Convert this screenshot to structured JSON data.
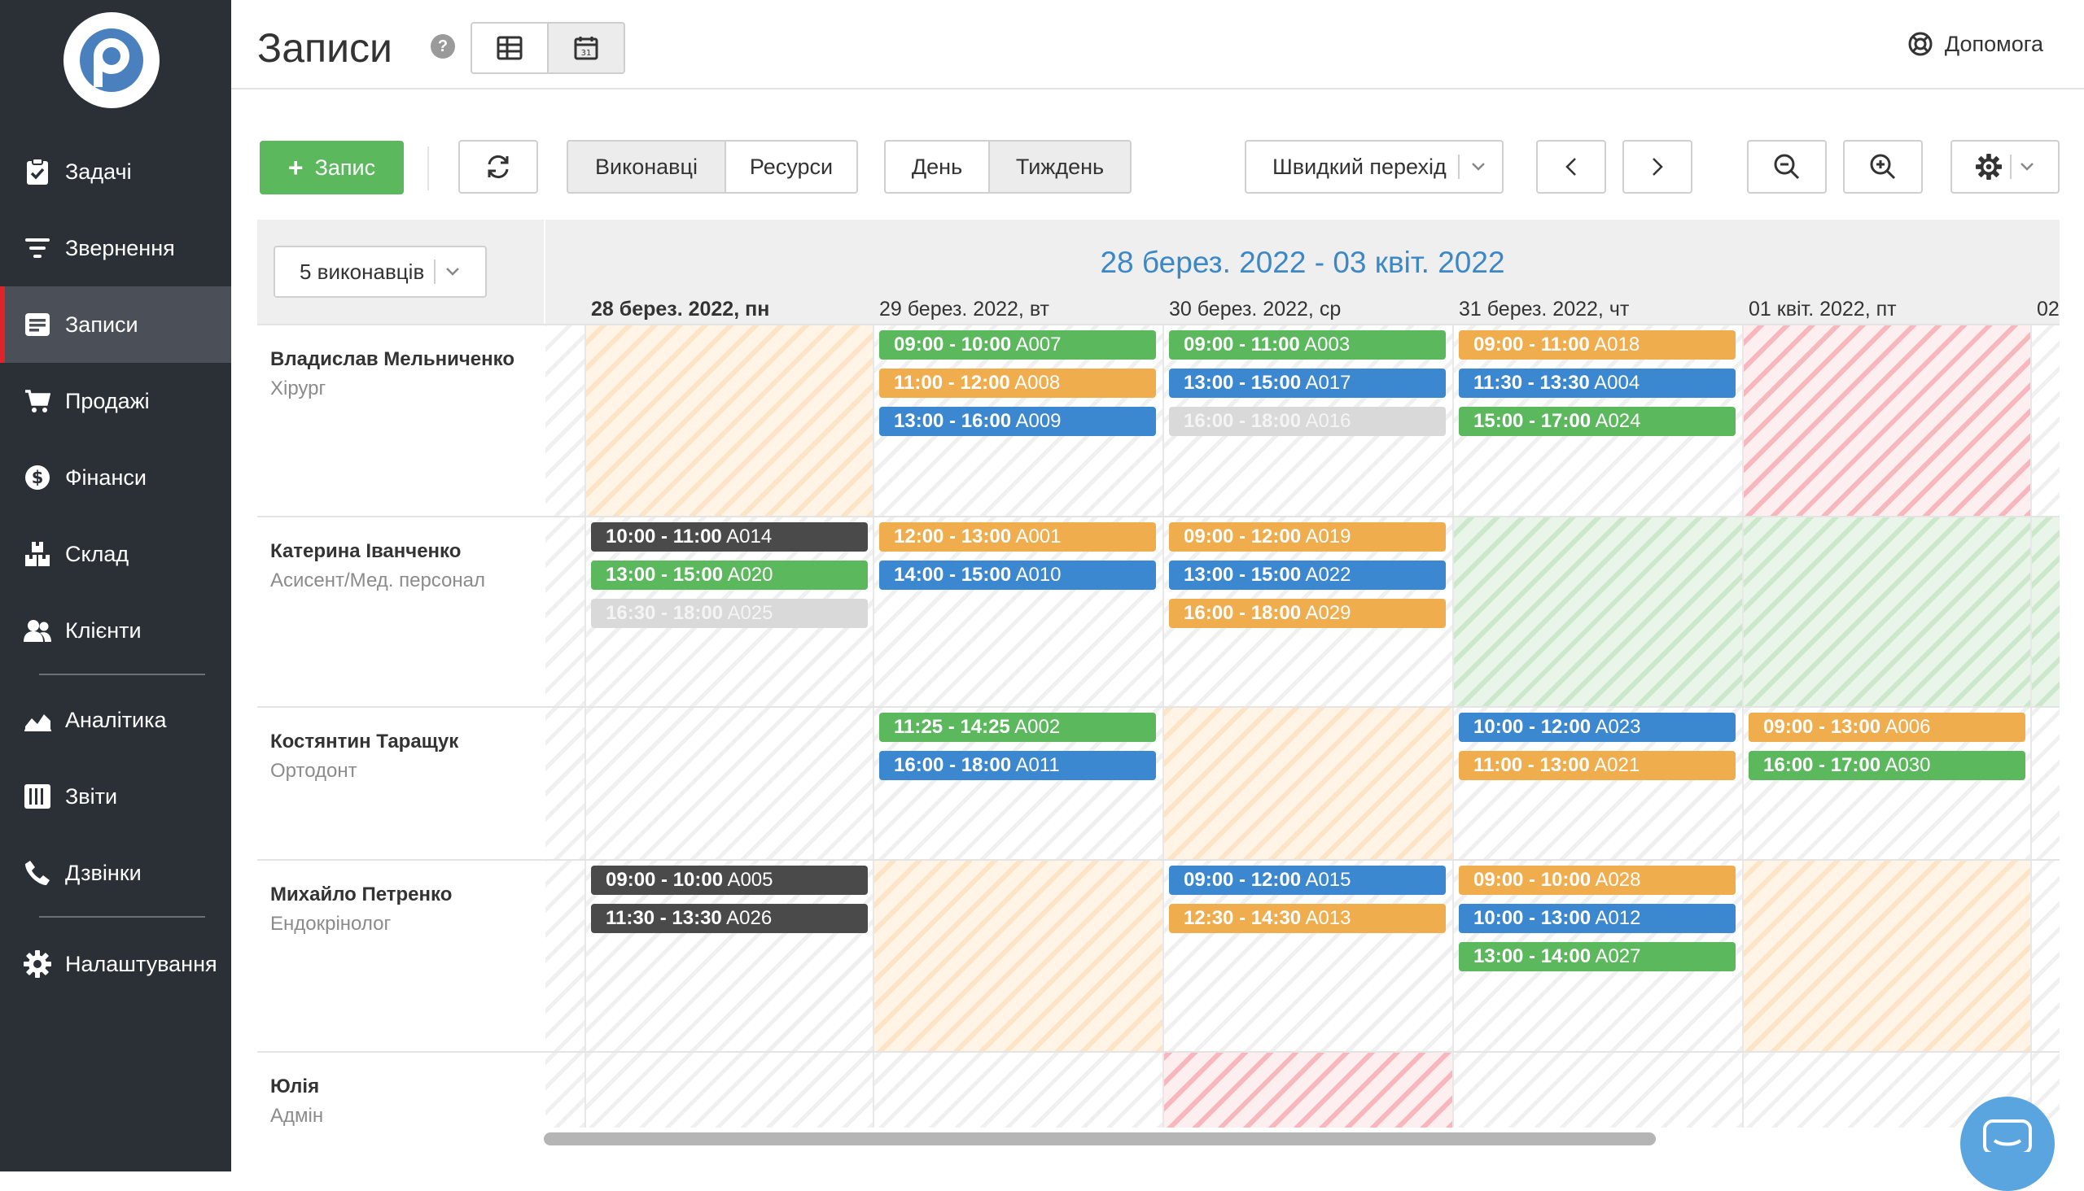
{
  "sidebar": {
    "items": [
      {
        "label": "Задачі",
        "icon": "clipboard-check-icon"
      },
      {
        "label": "Звернення",
        "icon": "filter-icon"
      },
      {
        "label": "Записи",
        "icon": "calendar-list-icon",
        "active": true
      },
      {
        "label": "Продажі",
        "icon": "cart-icon"
      },
      {
        "label": "Фінанси",
        "icon": "dollar-icon"
      },
      {
        "label": "Склад",
        "icon": "boxes-icon"
      },
      {
        "label": "Клієнти",
        "icon": "users-icon"
      },
      {
        "label": "Аналітика",
        "icon": "chart-area-icon"
      },
      {
        "label": "Звіти",
        "icon": "report-list-icon"
      },
      {
        "label": "Дзвінки",
        "icon": "phone-icon"
      },
      {
        "label": "Налаштування",
        "icon": "gear-icon"
      }
    ]
  },
  "header": {
    "title": "Записи",
    "help_label": "Допомога"
  },
  "toolbar": {
    "add_label": "Запис",
    "performers_label": "Виконавці",
    "resources_label": "Ресурси",
    "day_label": "День",
    "week_label": "Тиждень",
    "quick_jump_label": "Швидкий перехід"
  },
  "calendar": {
    "performers_filter": "5 виконавців",
    "range": "28 берез. 2022 - 03 квіт. 2022",
    "days": [
      "28 берез. 2022, пн",
      "29 берез. 2022, вт",
      "30 берез. 2022, ср",
      "31 берез. 2022, чт",
      "01 квіт. 2022, пт",
      "02"
    ],
    "performers": [
      {
        "name": "Владислав Мельниченко",
        "role": "Хірург"
      },
      {
        "name": "Катерина Іванченко",
        "role": "Асисент/Мед. персонал"
      },
      {
        "name": "Костянтин Таращук",
        "role": "Ортодонт"
      },
      {
        "name": "Михайло Петренко",
        "role": "Ендокрінолог"
      },
      {
        "name": "Юлія",
        "role": "Адмін"
      }
    ],
    "events": [
      {
        "performer": 0,
        "day": 1,
        "slot": 0,
        "time": "09:00 - 10:00",
        "code": "A007",
        "color": "#5bb85d"
      },
      {
        "performer": 0,
        "day": 1,
        "slot": 1,
        "time": "11:00 - 12:00",
        "code": "A008",
        "color": "#f0ad4e"
      },
      {
        "performer": 0,
        "day": 1,
        "slot": 2,
        "time": "13:00 - 16:00",
        "code": "A009",
        "color": "#3c88d0"
      },
      {
        "performer": 0,
        "day": 2,
        "slot": 0,
        "time": "09:00 - 11:00",
        "code": "A003",
        "color": "#5bb85d"
      },
      {
        "performer": 0,
        "day": 2,
        "slot": 1,
        "time": "13:00 - 15:00",
        "code": "A017",
        "color": "#3c88d0"
      },
      {
        "performer": 0,
        "day": 2,
        "slot": 2,
        "time": "16:00 - 18:00",
        "code": "A016",
        "color": "#d9d9d9"
      },
      {
        "performer": 0,
        "day": 3,
        "slot": 0,
        "time": "09:00 - 11:00",
        "code": "A018",
        "color": "#f0ad4e"
      },
      {
        "performer": 0,
        "day": 3,
        "slot": 1,
        "time": "11:30 - 13:30",
        "code": "A004",
        "color": "#3c88d0"
      },
      {
        "performer": 0,
        "day": 3,
        "slot": 2,
        "time": "15:00 - 17:00",
        "code": "A024",
        "color": "#5bb85d"
      },
      {
        "performer": 1,
        "day": 0,
        "slot": 0,
        "time": "10:00 - 11:00",
        "code": "A014",
        "color": "#4a4a4a"
      },
      {
        "performer": 1,
        "day": 0,
        "slot": 1,
        "time": "13:00 - 15:00",
        "code": "A020",
        "color": "#5bb85d"
      },
      {
        "performer": 1,
        "day": 0,
        "slot": 2,
        "time": "16:30 - 18:00",
        "code": "A025",
        "color": "#d9d9d9"
      },
      {
        "performer": 1,
        "day": 1,
        "slot": 0,
        "time": "12:00 - 13:00",
        "code": "A001",
        "color": "#f0ad4e"
      },
      {
        "performer": 1,
        "day": 1,
        "slot": 1,
        "time": "14:00 - 15:00",
        "code": "A010",
        "color": "#3c88d0"
      },
      {
        "performer": 1,
        "day": 2,
        "slot": 0,
        "time": "09:00 - 12:00",
        "code": "A019",
        "color": "#f0ad4e"
      },
      {
        "performer": 1,
        "day": 2,
        "slot": 1,
        "time": "13:00 - 15:00",
        "code": "A022",
        "color": "#3c88d0"
      },
      {
        "performer": 1,
        "day": 2,
        "slot": 2,
        "time": "16:00 - 18:00",
        "code": "A029",
        "color": "#f0ad4e"
      },
      {
        "performer": 2,
        "day": 1,
        "slot": 0,
        "time": "11:25 - 14:25",
        "code": "A002",
        "color": "#5bb85d"
      },
      {
        "performer": 2,
        "day": 1,
        "slot": 1,
        "time": "16:00 - 18:00",
        "code": "A011",
        "color": "#3c88d0"
      },
      {
        "performer": 2,
        "day": 3,
        "slot": 0,
        "time": "10:00 - 12:00",
        "code": "A023",
        "color": "#3c88d0"
      },
      {
        "performer": 2,
        "day": 3,
        "slot": 1,
        "time": "11:00 - 13:00",
        "code": "A021",
        "color": "#f0ad4e"
      },
      {
        "performer": 2,
        "day": 4,
        "slot": 0,
        "time": "09:00 - 13:00",
        "code": "A006",
        "color": "#f0ad4e"
      },
      {
        "performer": 2,
        "day": 4,
        "slot": 1,
        "time": "16:00 - 17:00",
        "code": "A030",
        "color": "#5bb85d"
      },
      {
        "performer": 3,
        "day": 0,
        "slot": 0,
        "time": "09:00 - 10:00",
        "code": "A005",
        "color": "#4a4a4a"
      },
      {
        "performer": 3,
        "day": 0,
        "slot": 1,
        "time": "11:30 - 13:30",
        "code": "A026",
        "color": "#4a4a4a"
      },
      {
        "performer": 3,
        "day": 2,
        "slot": 0,
        "time": "09:00 - 12:00",
        "code": "A015",
        "color": "#3c88d0"
      },
      {
        "performer": 3,
        "day": 2,
        "slot": 1,
        "time": "12:30 - 14:30",
        "code": "A013",
        "color": "#f0ad4e"
      },
      {
        "performer": 3,
        "day": 3,
        "slot": 0,
        "time": "09:00 - 10:00",
        "code": "A028",
        "color": "#f0ad4e"
      },
      {
        "performer": 3,
        "day": 3,
        "slot": 1,
        "time": "10:00 - 13:00",
        "code": "A012",
        "color": "#3c88d0"
      },
      {
        "performer": 3,
        "day": 3,
        "slot": 2,
        "time": "13:00 - 14:00",
        "code": "A027",
        "color": "#5bb85d"
      }
    ],
    "backgrounds": [
      [
        "orange",
        "gray",
        "gray",
        "gray",
        "red",
        "gray"
      ],
      [
        "gray",
        "gray",
        "gray",
        "green",
        "green",
        "green"
      ],
      [
        "gray",
        "gray",
        "orange",
        "gray",
        "gray",
        "gray"
      ],
      [
        "gray",
        "orange",
        "gray",
        "gray",
        "orange",
        "gray"
      ],
      [
        "gray",
        "gray",
        "red",
        "gray",
        "gray",
        "gray"
      ]
    ]
  }
}
